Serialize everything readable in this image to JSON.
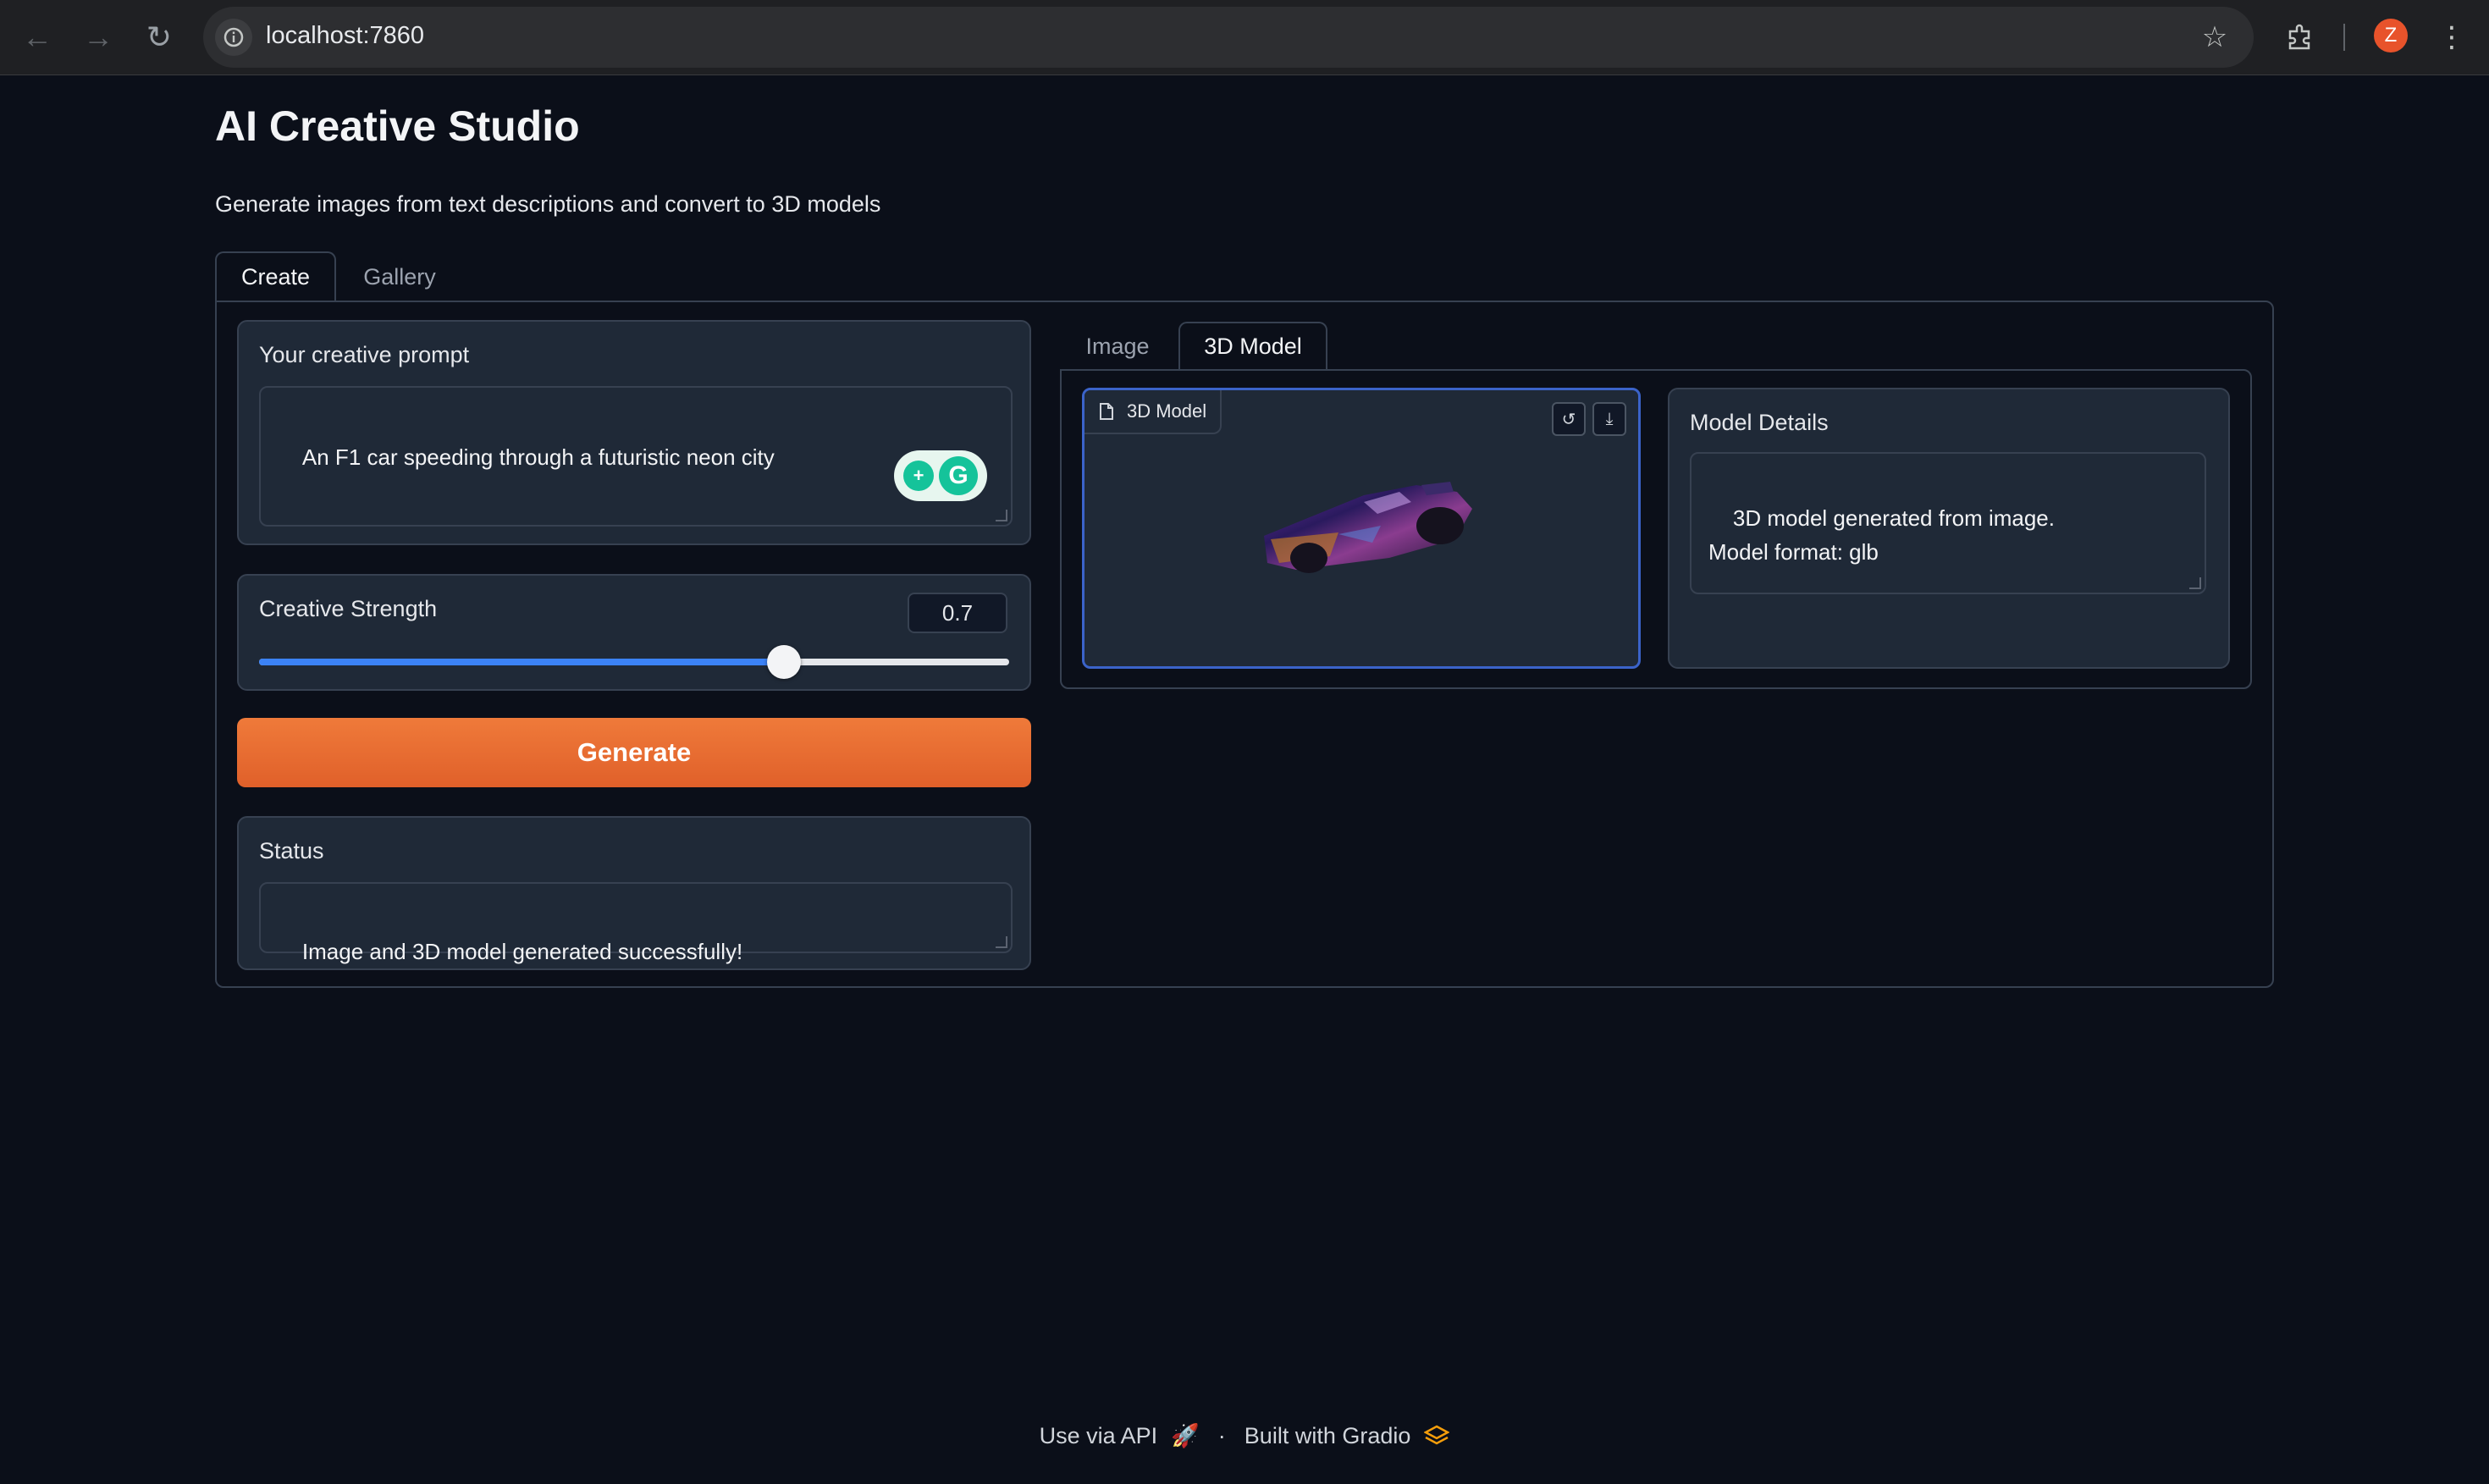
{
  "browser": {
    "url": "localhost:7860",
    "profile_initial": "Z"
  },
  "app": {
    "title": "AI Creative Studio",
    "subtitle": "Generate images from text descriptions and convert to 3D models"
  },
  "tabs": [
    {
      "label": "Create",
      "active": true
    },
    {
      "label": "Gallery",
      "active": false
    }
  ],
  "prompt": {
    "label": "Your creative prompt",
    "value": "An F1 car speeding through a futuristic neon city"
  },
  "strength": {
    "label": "Creative Strength",
    "value": "0.7",
    "fraction": 0.7
  },
  "generate": {
    "label": "Generate"
  },
  "status": {
    "label": "Status",
    "value": "Image and 3D model generated successfully!"
  },
  "output_tabs": [
    {
      "label": "Image",
      "active": false
    },
    {
      "label": "3D Model",
      "active": true
    }
  ],
  "model_viewer": {
    "label": "3D Model"
  },
  "model_details": {
    "label": "Model Details",
    "value": "3D model generated from image.\nModel format: glb"
  },
  "footer": {
    "api_label": "Use via API",
    "separator": "·",
    "built_label": "Built with Gradio"
  },
  "colors": {
    "background": "#0b0f19",
    "accent": "#e8692f",
    "slider": "#3b82f6",
    "focus": "#3b63c9"
  }
}
